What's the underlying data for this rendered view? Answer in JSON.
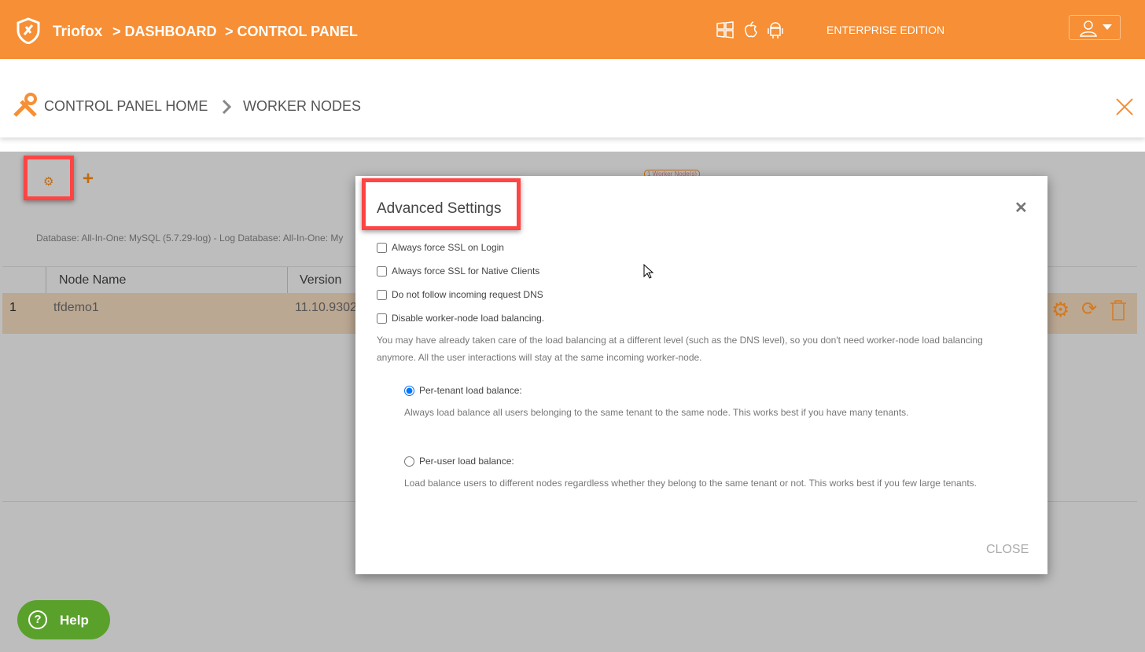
{
  "header": {
    "brand": "Triofox",
    "breadcrumbs": [
      "> DASHBOARD",
      "> CONTROL PANEL"
    ],
    "edition": "ENTERPRISE EDITION",
    "platform_icons": [
      "windows-icon",
      "apple-icon",
      "android-icon"
    ],
    "accent": "#f68f35"
  },
  "subheader": {
    "home": "CONTROL PANEL HOME",
    "current": "WORKER NODES"
  },
  "toolbar": {
    "badge": "1 Worker Node(s)"
  },
  "db_info": "Database: All-In-One: MySQL (5.7.29-log) - Log Database: All-In-One: My",
  "table": {
    "headers": [
      "Node Name",
      "Version"
    ],
    "rows": [
      {
        "index": "1",
        "name": "tfdemo1",
        "version": "11.10.9302"
      }
    ]
  },
  "help": "Help",
  "modal": {
    "title": "Advanced Settings",
    "options": [
      {
        "label": "Always force SSL on Login",
        "checked": false
      },
      {
        "label": "Always force SSL for Native Clients",
        "checked": false
      },
      {
        "label": "Do not follow incoming request DNS",
        "checked": false
      },
      {
        "label": "Disable worker-node load balancing.",
        "checked": false
      }
    ],
    "lb_description_1": "You may have already taken care of the load balancing at a different level (such as the DNS level), so you don't need worker-node load balancing",
    "lb_description_2": "anymore. All the user interactions will stay at the same incoming worker-node.",
    "radios": [
      {
        "label": "Per-tenant load balance:",
        "selected": true,
        "description": "Always load balance all users belonging to the same tenant to the same node. This works best if you have many tenants."
      },
      {
        "label": "Per-user load balance:",
        "selected": false,
        "description": "Load balance users to different nodes regardless whether they belong to the same tenant or not. This works best if you few large tenants."
      }
    ],
    "close": "CLOSE"
  }
}
